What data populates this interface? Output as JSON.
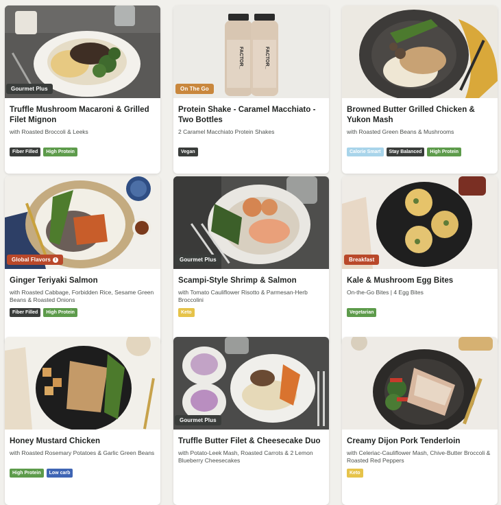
{
  "meals": [
    {
      "tag": "Gourmet Plus",
      "title": "Truffle Mushroom Macaroni & Grilled Filet Mignon",
      "subtitle": "with Roasted Broccoli & Leeks",
      "badges": [
        "Fiber Filled",
        "High Protein"
      ]
    },
    {
      "tag": "On The Go",
      "title": "Protein Shake - Caramel Macchiato - Two Bottles",
      "subtitle": "2 Caramel Macchiato Protein Shakes",
      "badges": [
        "Vegan"
      ],
      "bottle_label": "FACTOR_"
    },
    {
      "tag": "",
      "title": "Browned Butter Grilled Chicken & Yukon Mash",
      "subtitle": "with Roasted Green Beans & Mushrooms",
      "badges": [
        "Calorie Smart",
        "Stay Balanced",
        "High Protein"
      ]
    },
    {
      "tag": "Global Flavors",
      "tag_icon": "i",
      "title": "Ginger Teriyaki Salmon",
      "subtitle": "with Roasted Cabbage, Forbidden Rice, Sesame Green Beans & Roasted Onions",
      "badges": [
        "Fiber Filled",
        "High Protein"
      ]
    },
    {
      "tag": "Gourmet Plus",
      "title": "Scampi-Style Shrimp & Salmon",
      "subtitle": "with Tomato Cauliflower Risotto & Parmesan-Herb Broccolini",
      "badges": [
        "Keto"
      ]
    },
    {
      "tag": "Breakfast",
      "title": "Kale & Mushroom Egg Bites",
      "subtitle": "On-the-Go Bites | 4 Egg Bites",
      "badges": [
        "Vegetarian"
      ]
    },
    {
      "tag": "",
      "title": "Honey Mustard Chicken",
      "subtitle": "with Roasted Rosemary Potatoes & Garlic Green Beans",
      "badges": [
        "High Protein",
        "Low carb"
      ]
    },
    {
      "tag": "Gourmet Plus",
      "title": "Truffle Butter Filet & Cheesecake Duo",
      "subtitle": "with Potato-Leek Mash, Roasted Carrots & 2 Lemon Blueberry Cheesecakes",
      "badges": []
    },
    {
      "tag": "",
      "title": "Creamy Dijon Pork Tenderloin",
      "subtitle": "with Celeriac-Cauliflower Mash, Chive-Butter Broccoli & Roasted Red Peppers",
      "badges": [
        "Keto"
      ]
    }
  ],
  "colors": {
    "tag_dark": "#3a3d3b",
    "tag_on_the_go": "#c9873d",
    "tag_global": "#b9482a",
    "badge_green": "#5d9b4b",
    "badge_blue": "#3f65b4",
    "badge_keto": "#e6c34a",
    "badge_calorie_smart": "#a8d4ea"
  }
}
